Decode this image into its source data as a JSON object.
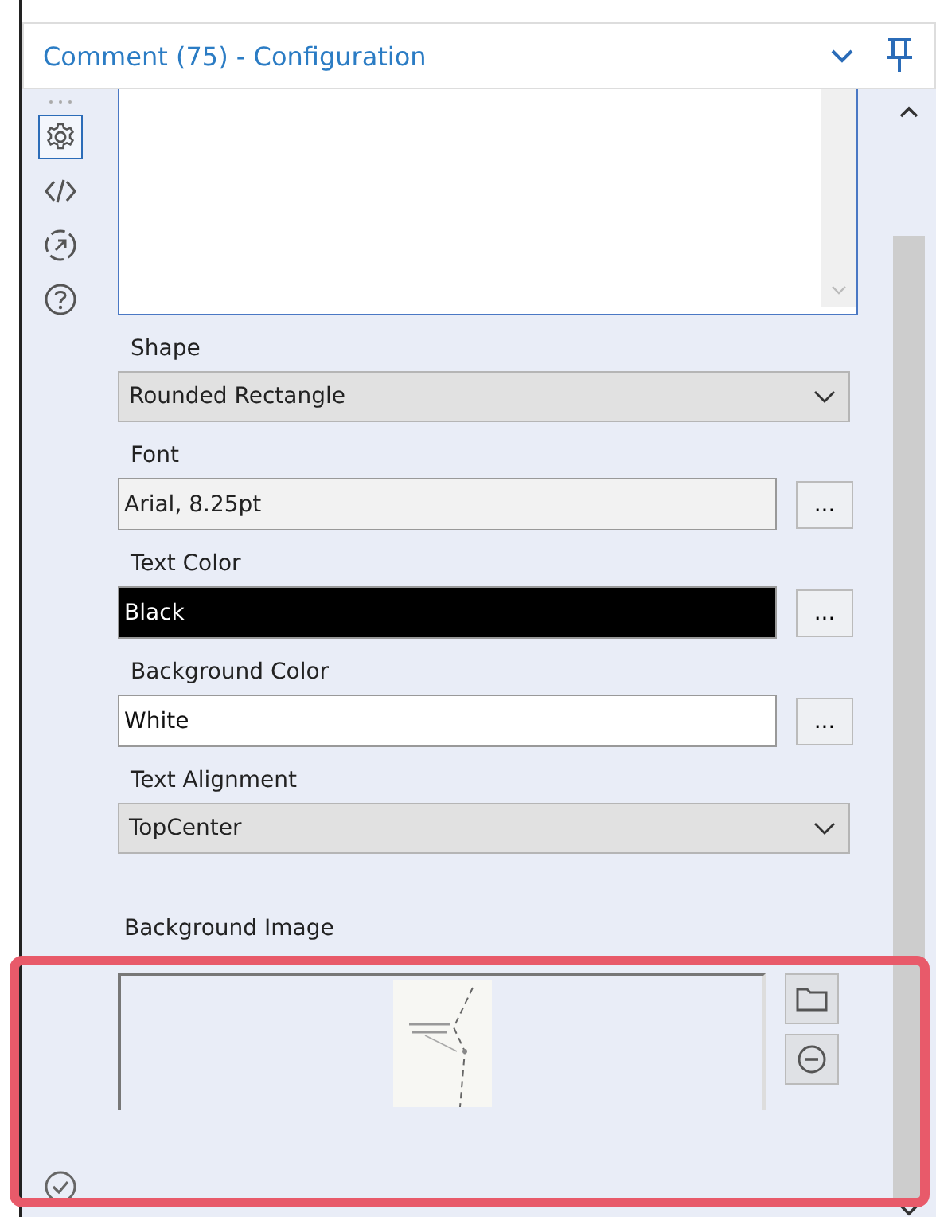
{
  "panel": {
    "title": "Comment (75) - Configuration"
  },
  "sidebar": [
    {
      "kind": "gear",
      "selected": true
    },
    {
      "kind": "code",
      "selected": false
    },
    {
      "kind": "share",
      "selected": false
    },
    {
      "kind": "help",
      "selected": false
    }
  ],
  "fields": [
    {
      "kind": "dropdown",
      "label": "Shape",
      "value": "Rounded Rectangle"
    },
    {
      "kind": "readonly",
      "label": "Font",
      "value": "Arial, 8.25pt",
      "button": "..."
    },
    {
      "kind": "color",
      "label": "Text Color",
      "value": "Black",
      "color": "#000000",
      "button": "..."
    },
    {
      "kind": "color",
      "label": "Background Color",
      "value": "White",
      "color": "#ffffff",
      "button": "..."
    },
    {
      "kind": "dropdown",
      "label": "Text Alignment",
      "value": "TopCenter"
    }
  ],
  "background_image": {
    "label": "Background Image",
    "highlighted": true
  }
}
